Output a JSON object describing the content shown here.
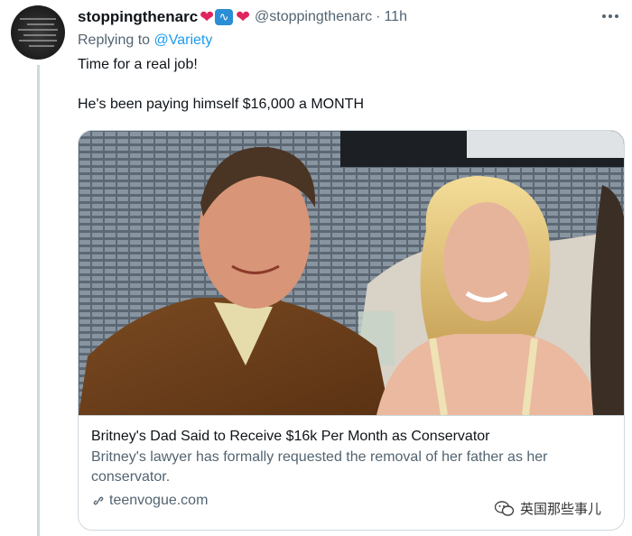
{
  "tweet": {
    "display_name": "stoppingthenarc",
    "name_emojis": [
      "red-heart",
      "water-wave",
      "red-heart"
    ],
    "handle": "@stoppingthenarc",
    "time": "11h",
    "reply_prefix": "Replying to",
    "reply_mention": "@Variety",
    "text_lines": [
      "Time for a real job!",
      "He's been paying himself $16,000 a MONTH"
    ]
  },
  "card": {
    "title": "Britney's Dad Said to Receive $16k Per Month as Conservator",
    "description": "Britney's lawyer has formally requested the removal of her father as her conservator.",
    "domain": "teenvogue.com"
  },
  "watermark": {
    "text": "英国那些事儿"
  },
  "colors": {
    "accent": "#1d9bf0",
    "secondary_text": "#536471",
    "heart": "#e0245e",
    "border": "#cfd9de"
  }
}
